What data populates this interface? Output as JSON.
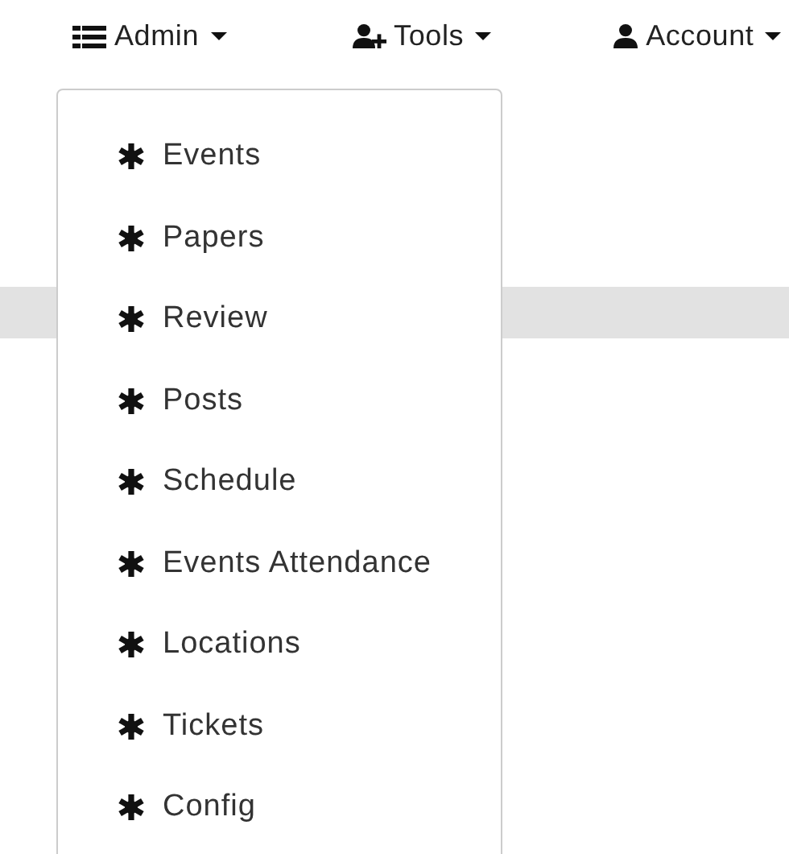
{
  "navbar": {
    "items": [
      {
        "label": "Admin"
      },
      {
        "label": "Tools"
      },
      {
        "label": "Account"
      }
    ]
  },
  "dropdown": {
    "items": [
      {
        "label": "Events"
      },
      {
        "label": "Papers"
      },
      {
        "label": "Review"
      },
      {
        "label": "Posts"
      },
      {
        "label": "Schedule"
      },
      {
        "label": "Events Attendance"
      },
      {
        "label": "Locations"
      },
      {
        "label": "Tickets"
      },
      {
        "label": "Config"
      }
    ]
  }
}
